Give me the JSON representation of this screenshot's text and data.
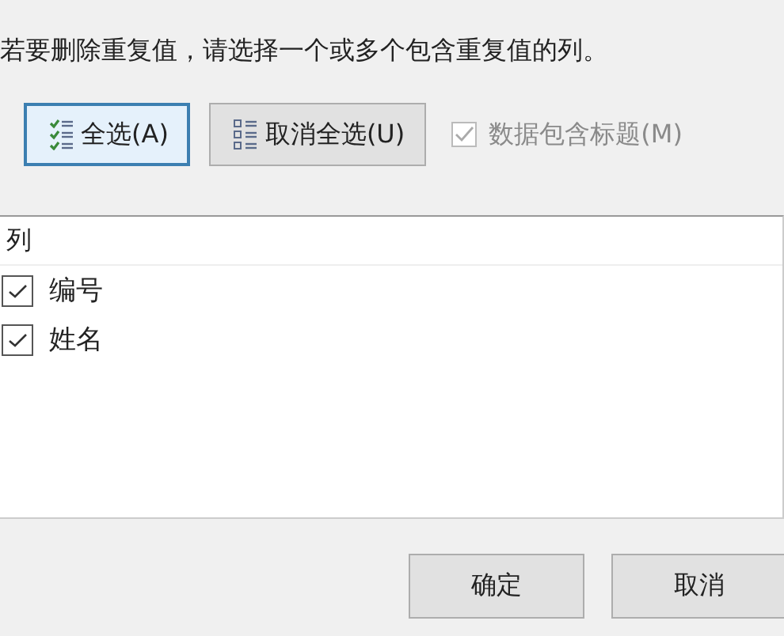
{
  "instruction": "若要删除重复值，请选择一个或多个包含重复值的列。",
  "select_buttons": [
    {
      "label": "全选(A)",
      "kind": "select-all",
      "focused": true
    },
    {
      "label": "取消全选(U)",
      "kind": "unselect-all",
      "focused": false
    }
  ],
  "header_checkbox": {
    "label": "数据包含标题(M)",
    "checked": true,
    "disabled": true
  },
  "column_list": {
    "header": "列",
    "items": [
      {
        "label": "编号",
        "checked": true
      },
      {
        "label": "姓名",
        "checked": true
      }
    ]
  },
  "footer_buttons": [
    "确定",
    "取消"
  ]
}
